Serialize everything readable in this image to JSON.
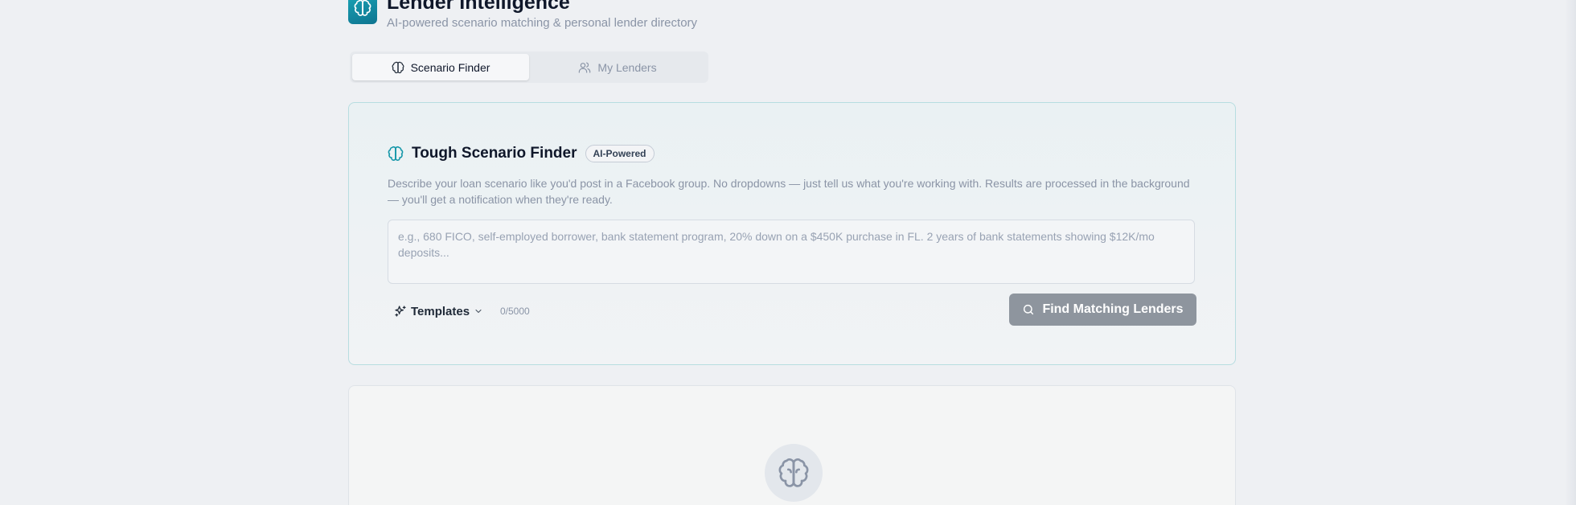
{
  "app": {
    "title": "Lender Intelligence",
    "subtitle": "AI-powered scenario matching & personal lender directory",
    "accent_color": "#1597a9"
  },
  "tabs": [
    {
      "label": "Scenario Finder",
      "icon": "brain-icon",
      "active": true
    },
    {
      "label": "My Lenders",
      "icon": "users-icon",
      "active": false
    }
  ],
  "finder": {
    "icon": "brain-icon",
    "title": "Tough Scenario Finder",
    "badge": "AI-Powered",
    "description": "Describe your loan scenario like you'd post in a Facebook group. No dropdowns — just tell us what you're working with. Results are processed in the background — you'll get a notification when they're ready.",
    "input_value": "",
    "input_placeholder": "e.g., 680 FICO, self-employed borrower, bank statement program, 20% down on a $450K purchase in FL. 2 years of bank statements showing $12K/mo deposits...",
    "templates_label": "Templates",
    "templates_icon": "sparkles-icon",
    "char_count": "0/5000",
    "submit_label": "Find Matching Lenders",
    "submit_icon": "search-icon"
  },
  "results": {
    "empty_icon": "brain-icon"
  }
}
